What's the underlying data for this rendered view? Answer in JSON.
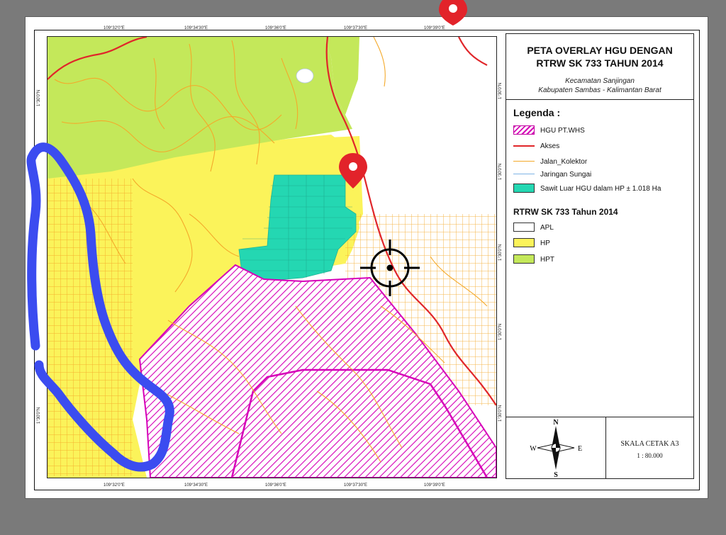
{
  "map": {
    "title": "PETA OVERLAY HGU DENGAN RTRW SK 733 TAHUN 2014",
    "title_line1": "PETA OVERLAY HGU DENGAN",
    "title_line2": "RTRW SK 733 TAHUN 2014",
    "subtitle_line1": "Kecamatan Sanjingan",
    "subtitle_line2": "Kabupaten Sambas - Kalimantan Barat",
    "legend_title": "Legenda :",
    "legend_items": [
      {
        "label": "HGU PT.WHS",
        "symbol": "hatch",
        "color": "#d600b8"
      },
      {
        "label": "Akses",
        "symbol": "line",
        "color": "#e0262a"
      },
      {
        "label": "Jalan_Kolektor",
        "symbol": "line",
        "color": "#f4a92a"
      },
      {
        "label": "Jaringan Sungai",
        "symbol": "line",
        "color": "#7fb4e6"
      },
      {
        "label": "Sawit Luar HGU dalam HP  ± 1.018 Ha",
        "symbol": "fill",
        "color": "#24d7b2"
      }
    ],
    "rtrw_title": "RTRW SK 733 Tahun 2014",
    "rtrw_items": [
      {
        "label": "APL",
        "color": "#ffffff"
      },
      {
        "label": "HP",
        "color": "#fbf35a"
      },
      {
        "label": "HPT",
        "color": "#c4e85a"
      }
    ],
    "compass": {
      "n": "N",
      "s": "S",
      "e": "E",
      "w": "W"
    },
    "scale_label": "SKALA CETAK A3",
    "scale_value": "1 : 80.000",
    "top_ticks": [
      "109°32'0\"E",
      "109°34'30\"E",
      "109°36'0\"E",
      "109°37'30\"E",
      "109°39'0\"E"
    ],
    "bottom_ticks": [
      "109°32'0\"E",
      "109°34'30\"E",
      "109°36'0\"E",
      "109°37'30\"E",
      "109°39'0\"E"
    ],
    "left_ticks": [
      "1°30'0\"N",
      "1°30'0\"N"
    ],
    "right_ticks": [
      "1°30'0\"N",
      "1°30'0\"N",
      "1°30'0\"N",
      "1°30'0\"N",
      "1°30'0\"N"
    ],
    "colors": {
      "hp": "#fbf35a",
      "hpt": "#c4e85a",
      "sawit": "#24d7b2",
      "hgu": "#d600b8",
      "akses": "#e0262a",
      "kolektor": "#f4a92a",
      "annotation_blue": "#3b4cf0",
      "pin_red": "#e2232a"
    }
  }
}
